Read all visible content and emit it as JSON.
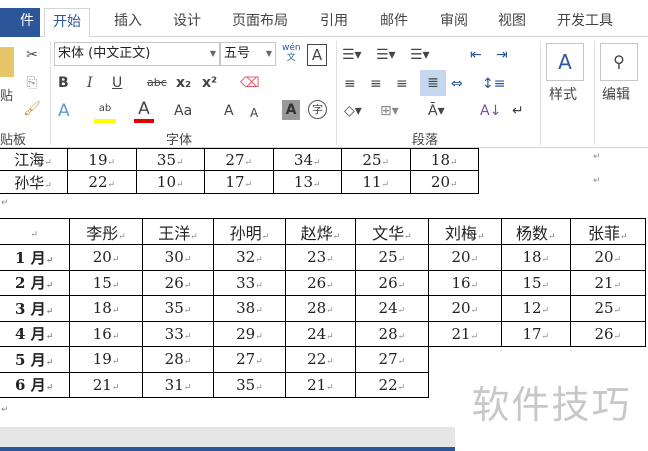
{
  "tabs": [
    "件",
    "开始",
    "插入",
    "设计",
    "页面布局",
    "引用",
    "邮件",
    "审阅",
    "视图",
    "开发工具"
  ],
  "ribbon": {
    "clipboard": {
      "paste": "贴",
      "label": "贴板"
    },
    "font": {
      "name": "宋体 (中文正文)",
      "size": "五号",
      "phonetic": "wén\n文",
      "bold": "B",
      "italic": "I",
      "underline": "U",
      "strike": "abc",
      "sub": "x₂",
      "sup": "x²",
      "grow": "A",
      "shrink": "A",
      "case": "Aa",
      "label": "字体"
    },
    "paragraph": {
      "label": "段落"
    },
    "styles": {
      "label": "样式"
    },
    "editing": {
      "label": "编辑"
    },
    "colors": {
      "highlight": "#ffff00",
      "font_color": "#e00000",
      "accent": "#2b579a"
    }
  },
  "table1": {
    "rows": [
      [
        "江海",
        "19",
        "35",
        "27",
        "34",
        "25",
        "18"
      ],
      [
        "孙华",
        "22",
        "10",
        "17",
        "13",
        "11",
        "20"
      ]
    ]
  },
  "table2": {
    "headers": [
      "",
      "李彤",
      "王洋",
      "孙明",
      "赵烨",
      "文华",
      "刘梅",
      "杨数",
      "张菲"
    ],
    "rows": [
      [
        "1 月",
        "20",
        "30",
        "32",
        "23",
        "25",
        "20",
        "18",
        "20"
      ],
      [
        "2 月",
        "15",
        "26",
        "33",
        "26",
        "26",
        "16",
        "15",
        "21"
      ],
      [
        "3 月",
        "18",
        "35",
        "38",
        "28",
        "24",
        "20",
        "12",
        "25"
      ],
      [
        "4 月",
        "16",
        "33",
        "29",
        "24",
        "28",
        "21",
        "17",
        "26"
      ],
      [
        "5 月",
        "19",
        "28",
        "27",
        "22",
        "27"
      ],
      [
        "6 月",
        "21",
        "31",
        "35",
        "21",
        "22"
      ]
    ]
  },
  "watermark": "软件技巧"
}
